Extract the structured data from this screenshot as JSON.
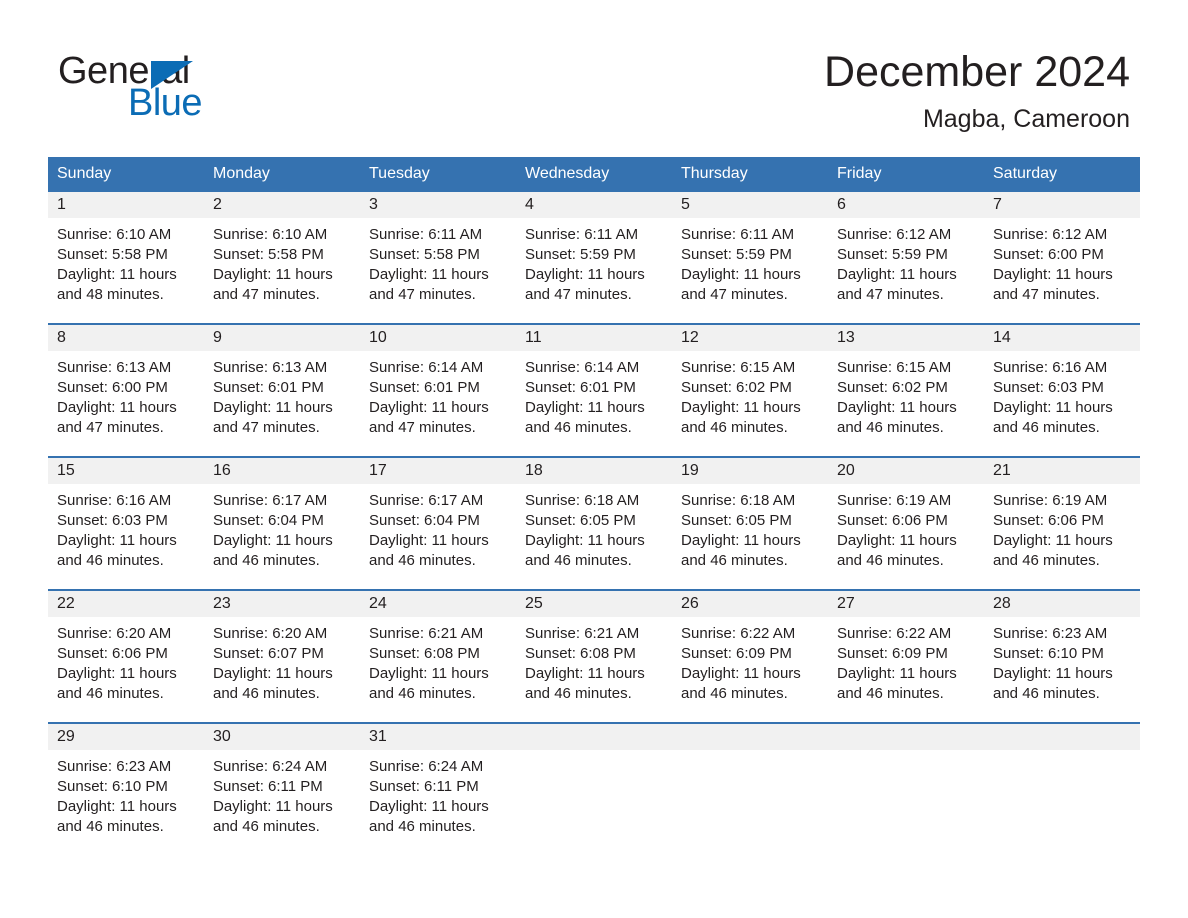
{
  "brand": {
    "word1": "General",
    "word2": "Blue",
    "triangle_color": "#0b6cb5"
  },
  "header": {
    "title": "December 2024",
    "subtitle": "Magba, Cameroon"
  },
  "colors": {
    "header_blue": "#3572b0",
    "brand_blue": "#0b6cb5",
    "day_band_gray": "#f1f1f1",
    "text": "#231f20"
  },
  "weekdays": [
    "Sunday",
    "Monday",
    "Tuesday",
    "Wednesday",
    "Thursday",
    "Friday",
    "Saturday"
  ],
  "weeks": [
    [
      {
        "day": "1",
        "sunrise": "Sunrise: 6:10 AM",
        "sunset": "Sunset: 5:58 PM",
        "daylight_line1": "Daylight: 11 hours",
        "daylight_line2": "and 48 minutes."
      },
      {
        "day": "2",
        "sunrise": "Sunrise: 6:10 AM",
        "sunset": "Sunset: 5:58 PM",
        "daylight_line1": "Daylight: 11 hours",
        "daylight_line2": "and 47 minutes."
      },
      {
        "day": "3",
        "sunrise": "Sunrise: 6:11 AM",
        "sunset": "Sunset: 5:58 PM",
        "daylight_line1": "Daylight: 11 hours",
        "daylight_line2": "and 47 minutes."
      },
      {
        "day": "4",
        "sunrise": "Sunrise: 6:11 AM",
        "sunset": "Sunset: 5:59 PM",
        "daylight_line1": "Daylight: 11 hours",
        "daylight_line2": "and 47 minutes."
      },
      {
        "day": "5",
        "sunrise": "Sunrise: 6:11 AM",
        "sunset": "Sunset: 5:59 PM",
        "daylight_line1": "Daylight: 11 hours",
        "daylight_line2": "and 47 minutes."
      },
      {
        "day": "6",
        "sunrise": "Sunrise: 6:12 AM",
        "sunset": "Sunset: 5:59 PM",
        "daylight_line1": "Daylight: 11 hours",
        "daylight_line2": "and 47 minutes."
      },
      {
        "day": "7",
        "sunrise": "Sunrise: 6:12 AM",
        "sunset": "Sunset: 6:00 PM",
        "daylight_line1": "Daylight: 11 hours",
        "daylight_line2": "and 47 minutes."
      }
    ],
    [
      {
        "day": "8",
        "sunrise": "Sunrise: 6:13 AM",
        "sunset": "Sunset: 6:00 PM",
        "daylight_line1": "Daylight: 11 hours",
        "daylight_line2": "and 47 minutes."
      },
      {
        "day": "9",
        "sunrise": "Sunrise: 6:13 AM",
        "sunset": "Sunset: 6:01 PM",
        "daylight_line1": "Daylight: 11 hours",
        "daylight_line2": "and 47 minutes."
      },
      {
        "day": "10",
        "sunrise": "Sunrise: 6:14 AM",
        "sunset": "Sunset: 6:01 PM",
        "daylight_line1": "Daylight: 11 hours",
        "daylight_line2": "and 47 minutes."
      },
      {
        "day": "11",
        "sunrise": "Sunrise: 6:14 AM",
        "sunset": "Sunset: 6:01 PM",
        "daylight_line1": "Daylight: 11 hours",
        "daylight_line2": "and 46 minutes."
      },
      {
        "day": "12",
        "sunrise": "Sunrise: 6:15 AM",
        "sunset": "Sunset: 6:02 PM",
        "daylight_line1": "Daylight: 11 hours",
        "daylight_line2": "and 46 minutes."
      },
      {
        "day": "13",
        "sunrise": "Sunrise: 6:15 AM",
        "sunset": "Sunset: 6:02 PM",
        "daylight_line1": "Daylight: 11 hours",
        "daylight_line2": "and 46 minutes."
      },
      {
        "day": "14",
        "sunrise": "Sunrise: 6:16 AM",
        "sunset": "Sunset: 6:03 PM",
        "daylight_line1": "Daylight: 11 hours",
        "daylight_line2": "and 46 minutes."
      }
    ],
    [
      {
        "day": "15",
        "sunrise": "Sunrise: 6:16 AM",
        "sunset": "Sunset: 6:03 PM",
        "daylight_line1": "Daylight: 11 hours",
        "daylight_line2": "and 46 minutes."
      },
      {
        "day": "16",
        "sunrise": "Sunrise: 6:17 AM",
        "sunset": "Sunset: 6:04 PM",
        "daylight_line1": "Daylight: 11 hours",
        "daylight_line2": "and 46 minutes."
      },
      {
        "day": "17",
        "sunrise": "Sunrise: 6:17 AM",
        "sunset": "Sunset: 6:04 PM",
        "daylight_line1": "Daylight: 11 hours",
        "daylight_line2": "and 46 minutes."
      },
      {
        "day": "18",
        "sunrise": "Sunrise: 6:18 AM",
        "sunset": "Sunset: 6:05 PM",
        "daylight_line1": "Daylight: 11 hours",
        "daylight_line2": "and 46 minutes."
      },
      {
        "day": "19",
        "sunrise": "Sunrise: 6:18 AM",
        "sunset": "Sunset: 6:05 PM",
        "daylight_line1": "Daylight: 11 hours",
        "daylight_line2": "and 46 minutes."
      },
      {
        "day": "20",
        "sunrise": "Sunrise: 6:19 AM",
        "sunset": "Sunset: 6:06 PM",
        "daylight_line1": "Daylight: 11 hours",
        "daylight_line2": "and 46 minutes."
      },
      {
        "day": "21",
        "sunrise": "Sunrise: 6:19 AM",
        "sunset": "Sunset: 6:06 PM",
        "daylight_line1": "Daylight: 11 hours",
        "daylight_line2": "and 46 minutes."
      }
    ],
    [
      {
        "day": "22",
        "sunrise": "Sunrise: 6:20 AM",
        "sunset": "Sunset: 6:06 PM",
        "daylight_line1": "Daylight: 11 hours",
        "daylight_line2": "and 46 minutes."
      },
      {
        "day": "23",
        "sunrise": "Sunrise: 6:20 AM",
        "sunset": "Sunset: 6:07 PM",
        "daylight_line1": "Daylight: 11 hours",
        "daylight_line2": "and 46 minutes."
      },
      {
        "day": "24",
        "sunrise": "Sunrise: 6:21 AM",
        "sunset": "Sunset: 6:08 PM",
        "daylight_line1": "Daylight: 11 hours",
        "daylight_line2": "and 46 minutes."
      },
      {
        "day": "25",
        "sunrise": "Sunrise: 6:21 AM",
        "sunset": "Sunset: 6:08 PM",
        "daylight_line1": "Daylight: 11 hours",
        "daylight_line2": "and 46 minutes."
      },
      {
        "day": "26",
        "sunrise": "Sunrise: 6:22 AM",
        "sunset": "Sunset: 6:09 PM",
        "daylight_line1": "Daylight: 11 hours",
        "daylight_line2": "and 46 minutes."
      },
      {
        "day": "27",
        "sunrise": "Sunrise: 6:22 AM",
        "sunset": "Sunset: 6:09 PM",
        "daylight_line1": "Daylight: 11 hours",
        "daylight_line2": "and 46 minutes."
      },
      {
        "day": "28",
        "sunrise": "Sunrise: 6:23 AM",
        "sunset": "Sunset: 6:10 PM",
        "daylight_line1": "Daylight: 11 hours",
        "daylight_line2": "and 46 minutes."
      }
    ],
    [
      {
        "day": "29",
        "sunrise": "Sunrise: 6:23 AM",
        "sunset": "Sunset: 6:10 PM",
        "daylight_line1": "Daylight: 11 hours",
        "daylight_line2": "and 46 minutes."
      },
      {
        "day": "30",
        "sunrise": "Sunrise: 6:24 AM",
        "sunset": "Sunset: 6:11 PM",
        "daylight_line1": "Daylight: 11 hours",
        "daylight_line2": "and 46 minutes."
      },
      {
        "day": "31",
        "sunrise": "Sunrise: 6:24 AM",
        "sunset": "Sunset: 6:11 PM",
        "daylight_line1": "Daylight: 11 hours",
        "daylight_line2": "and 46 minutes."
      },
      {
        "day": "",
        "sunrise": "",
        "sunset": "",
        "daylight_line1": "",
        "daylight_line2": ""
      },
      {
        "day": "",
        "sunrise": "",
        "sunset": "",
        "daylight_line1": "",
        "daylight_line2": ""
      },
      {
        "day": "",
        "sunrise": "",
        "sunset": "",
        "daylight_line1": "",
        "daylight_line2": ""
      },
      {
        "day": "",
        "sunrise": "",
        "sunset": "",
        "daylight_line1": "",
        "daylight_line2": ""
      }
    ]
  ]
}
